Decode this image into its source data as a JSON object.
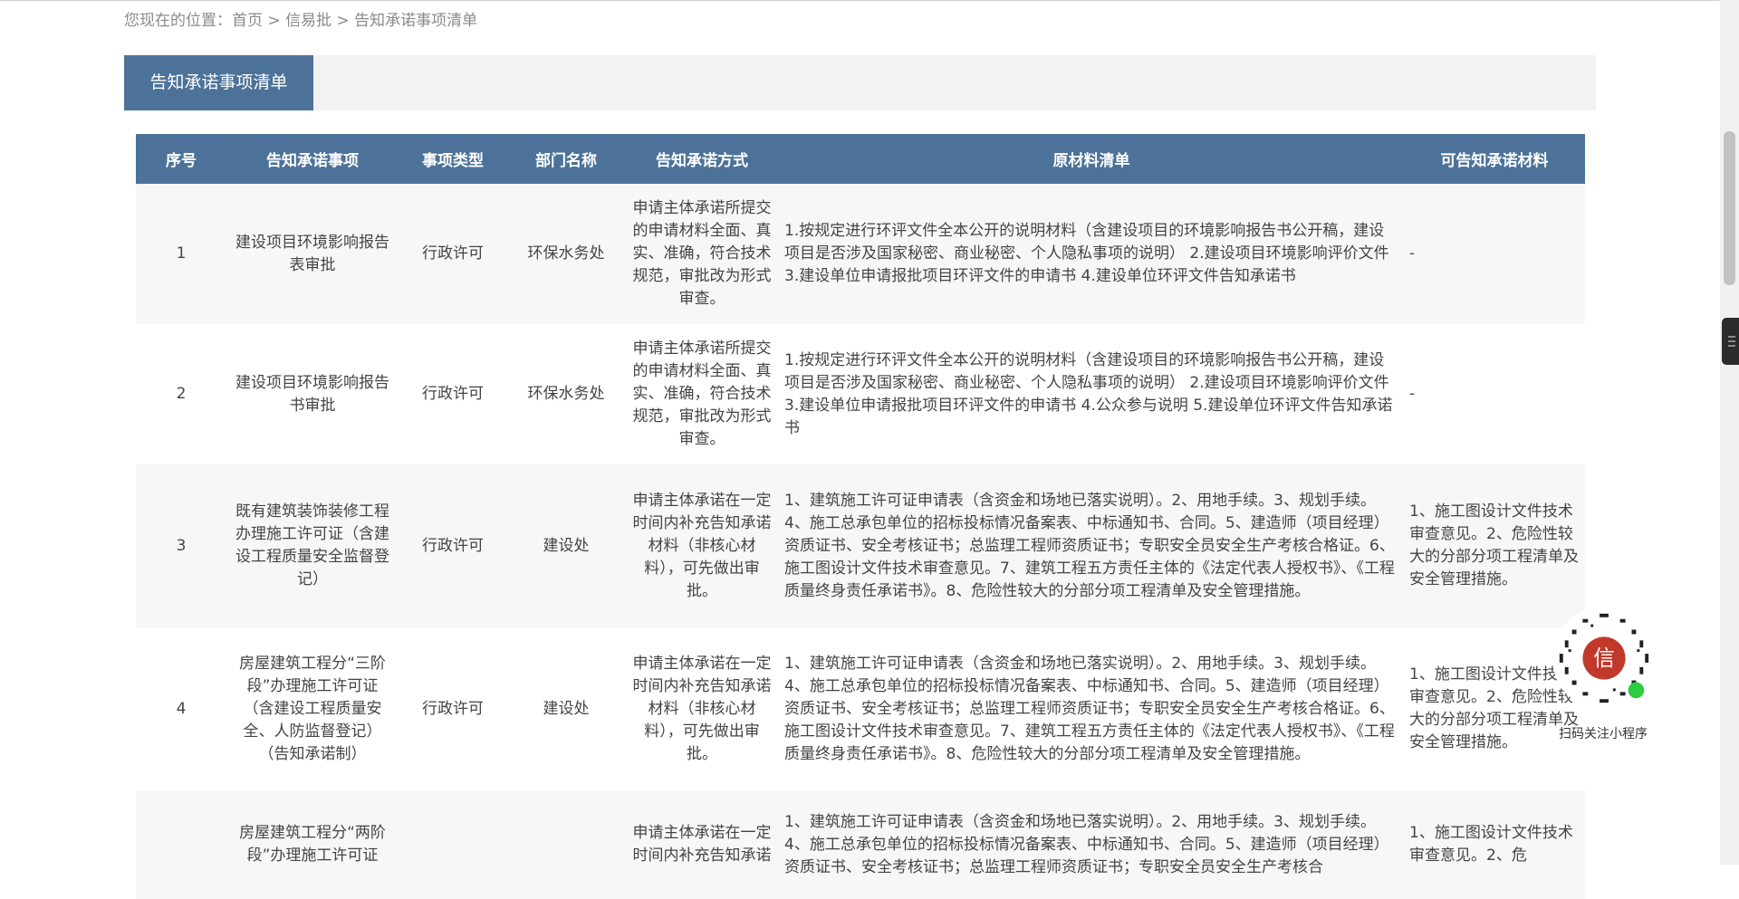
{
  "breadcrumb": {
    "prefix": "您现在的位置：",
    "home": "首页",
    "sep1": " > ",
    "section": "信易批",
    "sep2": " > ",
    "current": "告知承诺事项清单"
  },
  "panel": {
    "title": "告知承诺事项清单"
  },
  "table": {
    "headers": [
      "序号",
      "告知承诺事项",
      "事项类型",
      "部门名称",
      "告知承诺方式",
      "原材料清单",
      "可告知承诺材料"
    ],
    "rows": [
      {
        "no": "1",
        "item": "建设项目环境影响报告表审批",
        "type": "行政许可",
        "dept": "环保水务处",
        "method": "申请主体承诺所提交的申请材料全面、真实、准确，符合技术规范，审批改为形式审查。",
        "materials": "1.按规定进行环评文件全本公开的说明材料（含建设项目的环境影响报告书公开稿，建设项目是否涉及国家秘密、商业秘密、个人隐私事项的说明） 2.建设项目环境影响评价文件 3.建设单位申请报批项目环评文件的申请书 4.建设单位环评文件告知承诺书",
        "optional": "-"
      },
      {
        "no": "2",
        "item": "建设项目环境影响报告书审批",
        "type": "行政许可",
        "dept": "环保水务处",
        "method": "申请主体承诺所提交的申请材料全面、真实、准确，符合技术规范，审批改为形式审查。",
        "materials": "1.按规定进行环评文件全本公开的说明材料（含建设项目的环境影响报告书公开稿，建设项目是否涉及国家秘密、商业秘密、个人隐私事项的说明） 2.建设项目环境影响评价文件 3.建设单位申请报批项目环评文件的申请书 4.公众参与说明 5.建设单位环评文件告知承诺书",
        "optional": "-"
      },
      {
        "no": "3",
        "item": "既有建筑装饰装修工程办理施工许可证（含建设工程质量安全监督登记）",
        "type": "行政许可",
        "dept": "建设处",
        "method": "申请主体承诺在一定时间内补充告知承诺材料（非核心材料），可先做出审批。",
        "materials": "1、建筑施工许可证申请表（含资金和场地已落实说明）。2、用地手续。3、规划手续。4、施工总承包单位的招标投标情况备案表、中标通知书、合同。5、建造师（项目经理）资质证书、安全考核证书；总监理工程师资质证书；专职安全员安全生产考核合格证。6、施工图设计文件技术审查意见。7、建筑工程五方责任主体的《法定代表人授权书》、《工程质量终身责任承诺书》。8、危险性较大的分部分项工程清单及安全管理措施。",
        "optional": "1、施工图设计文件技术审查意见。2、危险性较大的分部分项工程清单及安全管理措施。"
      },
      {
        "no": "4",
        "item": "房屋建筑工程分“三阶段”办理施工许可证（含建设工程质量安全、人防监督登记）（告知承诺制）",
        "type": "行政许可",
        "dept": "建设处",
        "method": "申请主体承诺在一定时间内补充告知承诺材料（非核心材料），可先做出审批。",
        "materials": "1、建筑施工许可证申请表（含资金和场地已落实说明）。2、用地手续。3、规划手续。4、施工总承包单位的招标投标情况备案表、中标通知书、合同。5、建造师（项目经理）资质证书、安全考核证书；总监理工程师资质证书；专职安全员安全生产考核合格证。6、施工图设计文件技术审查意见。7、建筑工程五方责任主体的《法定代表人授权书》、《工程质量终身责任承诺书》。8、危险性较大的分部分项工程清单及安全管理措施。",
        "optional": "1、施工图设计文件技术审查意见。2、危险性较大的分部分项工程清单及安全管理措施。"
      },
      {
        "no": "",
        "item": "房屋建筑工程分“两阶段”办理施工许可证",
        "type": "",
        "dept": "",
        "method": "申请主体承诺在一定时间内补充告知承诺",
        "materials": "1、建筑施工许可证申请表（含资金和场地已落实说明）。2、用地手续。3、规划手续。4、施工总承包单位的招标投标情况备案表、中标通知书、合同。5、建造师（项目经理）资质证书、安全考核证书；总监理工程师资质证书；专职安全员安全生产考核合",
        "optional": "1、施工图设计文件技术审查意见。2、危"
      }
    ]
  },
  "qr": {
    "caption": "扫码关注小程序",
    "glyph": "信",
    "icon": "mini-program-qr-icon"
  }
}
